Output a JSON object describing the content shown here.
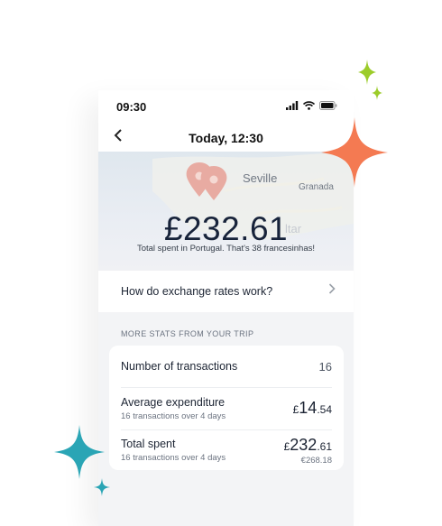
{
  "status_bar": {
    "time": "09:30"
  },
  "nav": {
    "back_icon": "chevron-left-icon",
    "title": "Today, 12:30"
  },
  "map": {
    "labels": [
      "Seville",
      "Granada",
      "ltar"
    ],
    "pin_color": "#e8a096"
  },
  "summary": {
    "amount": "£232.61",
    "caption": "Total spent in Portugal. That's 38 francesinhas!"
  },
  "faq": {
    "label": "How do exchange rates work?",
    "chevron_icon": "chevron-right-icon"
  },
  "stats": {
    "section_title": "MORE STATS FROM YOUR TRIP",
    "transactions": {
      "label": "Number of transactions",
      "value": "16"
    },
    "average": {
      "label": "Average expenditure",
      "sub": "16 transactions over 4 days",
      "currency": "£",
      "whole": "14",
      "decimals": ".54"
    },
    "total": {
      "label": "Total spent",
      "sub": "16 transactions over 4 days",
      "currency": "£",
      "whole": "232",
      "decimals": ".61",
      "secondary": "€268.18"
    }
  },
  "decor": {
    "orange_color": "#f47a52",
    "green_color": "#9ccc2a",
    "teal_color": "#2aa5b5"
  }
}
